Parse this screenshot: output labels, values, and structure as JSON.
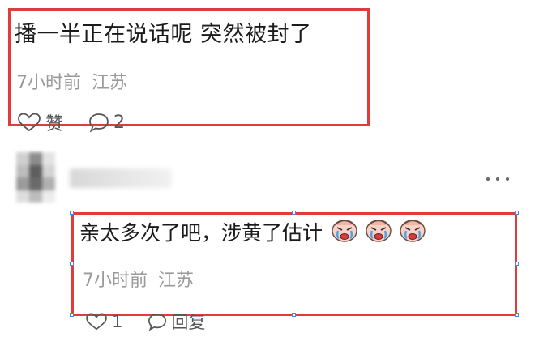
{
  "comment_1": {
    "text": "播一半正在说话呢 突然被封了",
    "time": "7小时前",
    "location": "江苏",
    "like_label": "赞",
    "reply_count": "2"
  },
  "comment_2": {
    "text": "亲太多次了吧，涉黄了估计",
    "emoji_count": 3,
    "time": "7小时前",
    "location": "江苏",
    "like_count": "1",
    "reply_label": "回复"
  },
  "icons": {
    "like": "heart-outline-icon",
    "reply": "speech-bubble-icon",
    "more": "ellipsis-icon",
    "emoji": "crying-face-emoji"
  },
  "colors": {
    "highlight_border": "#e23b3b",
    "meta_text": "#9a9a9a",
    "selection_handle": "#4a86e8"
  }
}
